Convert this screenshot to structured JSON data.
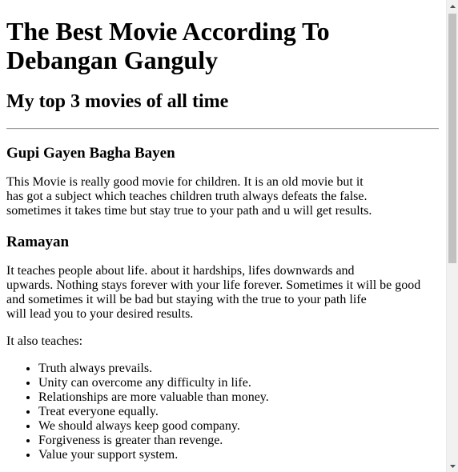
{
  "header": {
    "title": "The Best Movie According To Debangan Ganguly",
    "subtitle": "My top 3 movies of all time"
  },
  "movies": [
    {
      "name": "Gupi Gayen Bagha Bayen",
      "description": "This Movie is really good movie for children. It is an old movie but it\nhas got a subject which teaches children truth always defeats the false.\nsometimes it takes time but stay true to your path and u will get results."
    },
    {
      "name": "Ramayan",
      "description": "It teaches people about life. about it hardships, lifes downwards and\nupwards. Nothing stays forever with your life forever. Sometimes it will be good\nand sometimes it will be bad but staying with the true to your path life\nwill lead you to your desired results.",
      "also_teaches_label": "It also teaches:",
      "lessons": [
        "Truth always prevails.",
        "Unity can overcome any difficulty in life.",
        "Relationships are more valuable than money.",
        "Treat everyone equally.",
        "We should always keep good company.",
        "Forgiveness is greater than revenge.",
        "Value your support system."
      ]
    }
  ],
  "scrollbar": {
    "scroll_position": 0,
    "visible_fraction": 0.54
  }
}
